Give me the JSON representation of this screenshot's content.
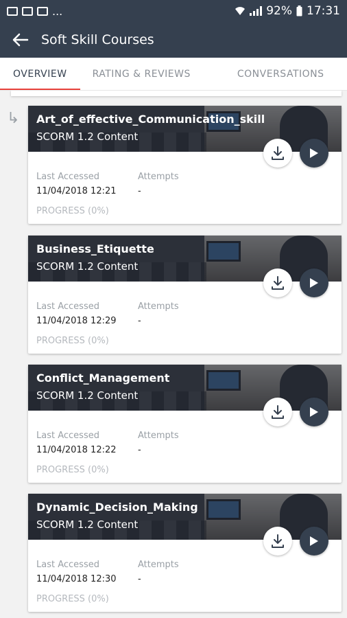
{
  "status_bar": {
    "dots": "...",
    "battery": "92%",
    "time": "17:31"
  },
  "app_bar": {
    "title": "Soft Skill Courses"
  },
  "tabs": [
    {
      "label": "OVERVIEW",
      "active": true
    },
    {
      "label": "RATING & REVIEWS",
      "active": false
    },
    {
      "label": "CONVERSATIONS",
      "active": false
    }
  ],
  "labels": {
    "last_accessed": "Last Accessed",
    "attempts": "Attempts"
  },
  "courses": [
    {
      "name": "Art_of_effective_Communication_skill",
      "type": "SCORM 1.2 Content",
      "last_accessed": "11/04/2018 12:21",
      "attempts": "-",
      "progress_label": "PROGRESS (0%)",
      "progress": 0
    },
    {
      "name": "Business_Etiquette",
      "type": "SCORM 1.2 Content",
      "last_accessed": "11/04/2018 12:29",
      "attempts": "-",
      "progress_label": "PROGRESS (0%)",
      "progress": 0
    },
    {
      "name": "Conflict_Management",
      "type": "SCORM 1.2 Content",
      "last_accessed": "11/04/2018 12:22",
      "attempts": "-",
      "progress_label": "PROGRESS (0%)",
      "progress": 0
    },
    {
      "name": "Dynamic_Decision_Making",
      "type": "SCORM 1.2 Content",
      "last_accessed": "11/04/2018 12:30",
      "attempts": "-",
      "progress_label": "PROGRESS (0%)",
      "progress": 0
    }
  ],
  "colors": {
    "primary": "#35404f",
    "accent": "#e8403a"
  }
}
